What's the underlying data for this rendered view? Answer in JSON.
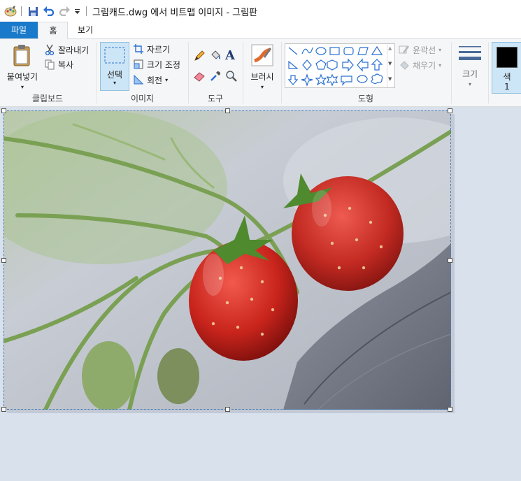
{
  "window": {
    "title": "그림캐드.dwg 에서 비트맵 이미지 - 그림판"
  },
  "quick_access": {
    "icons": [
      "paint-app-icon",
      "save-icon",
      "undo-icon",
      "redo-icon",
      "customize-dropdown-icon"
    ]
  },
  "tabs": [
    {
      "label": "파일"
    },
    {
      "label": "홈"
    },
    {
      "label": "보기"
    }
  ],
  "ribbon": {
    "clipboard": {
      "paste_label": "붙여넣기",
      "cut_label": "잘라내기",
      "copy_label": "복사",
      "group_label": "클립보드"
    },
    "image": {
      "select_label": "선택",
      "crop_label": "자르기",
      "resize_label": "크기 조정",
      "rotate_label": "회전",
      "group_label": "이미지"
    },
    "tools": {
      "group_label": "도구"
    },
    "brushes": {
      "label": "브러시"
    },
    "shapes": {
      "outline_label": "윤곽선",
      "fill_label": "채우기",
      "group_label": "도형"
    },
    "size": {
      "label": "크기"
    },
    "color1": {
      "label": "색",
      "sub": "1",
      "color": "#000000"
    }
  },
  "colors": {
    "accent": "#1979ca",
    "selected_bg": "#cde6f7",
    "canvas_bg": "#d9e1ec"
  },
  "canvas": {
    "content": "photo"
  }
}
